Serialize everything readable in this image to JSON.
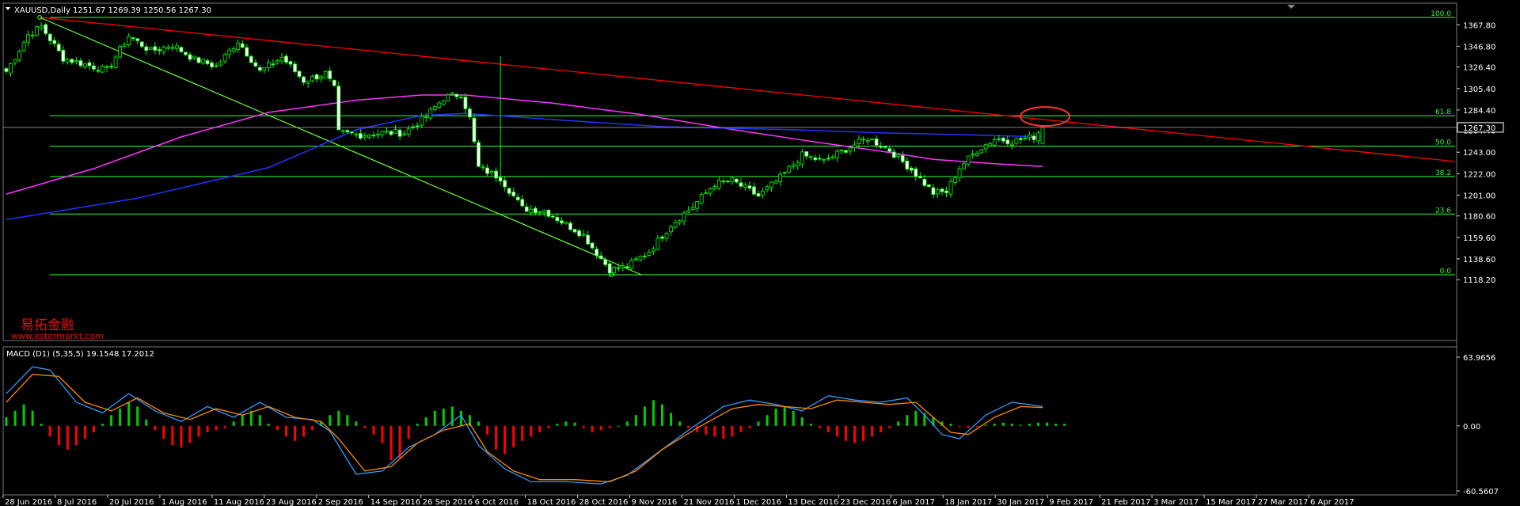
{
  "header": {
    "symbol_title": "XAUUSD,Daily",
    "ohlc": "1251.67 1269.39 1250.56 1267.30",
    "collapse_icon": "triangle-down-icon"
  },
  "watermark": {
    "brand": "易拓金融",
    "url": "www.estermarkt.com"
  },
  "colors": {
    "background": "#000000",
    "bull_candle": "#00ff00",
    "bear_candle": "#ffffff",
    "fib_lines": "#33ff33",
    "trendline_resistance": "#ff0000",
    "trendline_fib_anchor": "#66ff33",
    "ma_magenta": "#ff33ff",
    "ma_blue": "#2233ff",
    "macd_line": "#3399ff",
    "signal_line": "#ff8800",
    "hist_positive": "#00cc00",
    "hist_negative": "#ff0000",
    "highlight_ellipse": "#ff3333"
  },
  "price_axis": {
    "ticks": [
      "1367.80",
      "1346.80",
      "1326.40",
      "1305.40",
      "1284.40",
      "1264.40",
      "1243.00",
      "1222.00",
      "1201.00",
      "1180.60",
      "1159.60",
      "1138.60",
      "1118.20"
    ],
    "current_price": "1267.30"
  },
  "time_axis": {
    "labels": [
      "28 Jun 2016",
      "8 Jul 2016",
      "20 Jul 2016",
      "1 Aug 2016",
      "11 Aug 2016",
      "23 Aug 2016",
      "2 Sep 2016",
      "14 Sep 2016",
      "26 Sep 2016",
      "6 Oct 2016",
      "18 Oct 2016",
      "28 Oct 2016",
      "9 Nov 2016",
      "21 Nov 2016",
      "1 Dec 2016",
      "13 Dec 2016",
      "23 Dec 2016",
      "6 Jan 2017",
      "18 Jan 2017",
      "30 Jan 2017",
      "9 Feb 2017",
      "21 Feb 2017",
      "3 Mar 2017",
      "15 Mar 2017",
      "27 Mar 2017",
      "6 Apr 2017"
    ]
  },
  "fib_levels": [
    "100.0",
    "61.8",
    "50.0",
    "38.2",
    "23.6",
    "0.0"
  ],
  "macd": {
    "title": "MACD (D1) (5,35,5) 19.1548 17.2012",
    "axis_ticks": [
      "63.9656",
      "0.00",
      "-60.5607"
    ]
  },
  "chart_data": {
    "type": "candlestick",
    "symbol": "XAUUSD",
    "timeframe": "Daily",
    "last_bar": {
      "open": 1251.67,
      "high": 1269.39,
      "low": 1250.56,
      "close": 1267.3
    },
    "ylim": [
      1112,
      1381
    ],
    "close_path": [
      [
        0,
        1322
      ],
      [
        5,
        1358
      ],
      [
        8,
        1366
      ],
      [
        13,
        1335
      ],
      [
        18,
        1329
      ],
      [
        23,
        1323
      ],
      [
        28,
        1357
      ],
      [
        33,
        1342
      ],
      [
        38,
        1348
      ],
      [
        43,
        1334
      ],
      [
        48,
        1327
      ],
      [
        53,
        1352
      ],
      [
        58,
        1322
      ],
      [
        63,
        1336
      ],
      [
        68,
        1313
      ],
      [
        73,
        1320
      ],
      [
        75,
        1305
      ],
      [
        76,
        1262
      ],
      [
        81,
        1260
      ],
      [
        86,
        1262
      ],
      [
        91,
        1262
      ],
      [
        96,
        1278
      ],
      [
        100,
        1296
      ],
      [
        104,
        1300
      ],
      [
        106,
        1276
      ],
      [
        108,
        1228
      ],
      [
        113,
        1218
      ],
      [
        118,
        1188
      ],
      [
        123,
        1186
      ],
      [
        127,
        1175
      ],
      [
        132,
        1162
      ],
      [
        134,
        1150
      ],
      [
        138,
        1128
      ],
      [
        142,
        1131
      ],
      [
        147,
        1146
      ],
      [
        152,
        1172
      ],
      [
        157,
        1190
      ],
      [
        162,
        1212
      ],
      [
        166,
        1215
      ],
      [
        172,
        1200
      ],
      [
        177,
        1218
      ],
      [
        182,
        1240
      ],
      [
        187,
        1234
      ],
      [
        192,
        1246
      ],
      [
        197,
        1257
      ],
      [
        202,
        1245
      ],
      [
        207,
        1226
      ],
      [
        212,
        1203
      ],
      [
        215,
        1204
      ],
      [
        218,
        1228
      ],
      [
        222,
        1245
      ],
      [
        226,
        1256
      ],
      [
        230,
        1254
      ],
      [
        235,
        1258
      ],
      [
        237,
        1267.3
      ]
    ],
    "fibonacci": {
      "anchor_high": 1375,
      "anchor_low": 1123,
      "levels": [
        100.0,
        61.8,
        50.0,
        38.2,
        23.6,
        0.0
      ]
    },
    "trendlines": {
      "resistance": [
        [
          8,
          1375
        ],
        [
          265,
          1234
        ]
      ],
      "fib_anchor": [
        [
          8,
          1375
        ],
        [
          138,
          1123
        ]
      ]
    },
    "ma_magenta_path": [
      [
        0,
        1202
      ],
      [
        20,
        1227
      ],
      [
        40,
        1258
      ],
      [
        60,
        1282
      ],
      [
        80,
        1294
      ],
      [
        95,
        1299
      ],
      [
        105,
        1299
      ],
      [
        125,
        1291
      ],
      [
        145,
        1280
      ],
      [
        165,
        1266
      ],
      [
        185,
        1253
      ],
      [
        200,
        1244
      ],
      [
        212,
        1236
      ],
      [
        225,
        1232
      ],
      [
        237,
        1229
      ]
    ],
    "ma_blue_path": [
      [
        0,
        1177
      ],
      [
        30,
        1198
      ],
      [
        60,
        1228
      ],
      [
        80,
        1265
      ],
      [
        95,
        1279
      ],
      [
        105,
        1281
      ],
      [
        125,
        1275
      ],
      [
        150,
        1268
      ],
      [
        180,
        1265
      ],
      [
        200,
        1262
      ],
      [
        220,
        1260
      ],
      [
        237,
        1258
      ]
    ],
    "macd_hist": [
      8,
      14,
      20,
      14,
      2,
      -10,
      -18,
      -22,
      -18,
      -12,
      -6,
      2,
      10,
      16,
      22,
      18,
      6,
      -4,
      -12,
      -18,
      -20,
      -16,
      -10,
      -6,
      -4,
      -2,
      4,
      10,
      14,
      10,
      2,
      -4,
      -10,
      -14,
      -10,
      -4,
      4,
      10,
      14,
      10,
      4,
      -2,
      -8,
      -16,
      -32,
      -30,
      -12,
      2,
      8,
      14,
      16,
      18,
      14,
      10,
      4,
      -8,
      -22,
      -26,
      -20,
      -14,
      -10,
      -6,
      -2,
      2,
      4,
      3,
      -2,
      -6,
      -4,
      -2,
      0,
      4,
      10,
      18,
      24,
      20,
      12,
      4,
      -2,
      -6,
      -8,
      -10,
      -12,
      -10,
      -6,
      -2,
      4,
      10,
      16,
      18,
      14,
      8,
      2,
      -2,
      -6,
      -10,
      -14,
      -16,
      -14,
      -10,
      -6,
      -2,
      4,
      10,
      14,
      12,
      8,
      4,
      2,
      -1,
      -2,
      -1,
      1,
      2,
      3,
      2,
      1,
      2,
      3,
      3,
      2,
      2
    ],
    "macd_line": [
      [
        0,
        30
      ],
      [
        6,
        55
      ],
      [
        10,
        52
      ],
      [
        16,
        22
      ],
      [
        22,
        12
      ],
      [
        28,
        30
      ],
      [
        34,
        14
      ],
      [
        40,
        4
      ],
      [
        46,
        18
      ],
      [
        52,
        8
      ],
      [
        58,
        22
      ],
      [
        64,
        8
      ],
      [
        70,
        6
      ],
      [
        74,
        -5
      ],
      [
        80,
        -45
      ],
      [
        86,
        -42
      ],
      [
        92,
        -20
      ],
      [
        98,
        -8
      ],
      [
        104,
        10
      ],
      [
        108,
        -18
      ],
      [
        114,
        -40
      ],
      [
        120,
        -52
      ],
      [
        128,
        -52
      ],
      [
        136,
        -54
      ],
      [
        142,
        -46
      ],
      [
        148,
        -28
      ],
      [
        156,
        -4
      ],
      [
        164,
        18
      ],
      [
        170,
        24
      ],
      [
        176,
        20
      ],
      [
        182,
        14
      ],
      [
        188,
        28
      ],
      [
        194,
        24
      ],
      [
        200,
        22
      ],
      [
        206,
        26
      ],
      [
        210,
        10
      ],
      [
        214,
        -8
      ],
      [
        218,
        -12
      ],
      [
        224,
        10
      ],
      [
        230,
        22
      ],
      [
        237,
        18
      ]
    ],
    "signal_line": [
      [
        0,
        22
      ],
      [
        6,
        48
      ],
      [
        12,
        46
      ],
      [
        18,
        22
      ],
      [
        24,
        14
      ],
      [
        30,
        26
      ],
      [
        36,
        12
      ],
      [
        42,
        6
      ],
      [
        48,
        16
      ],
      [
        54,
        10
      ],
      [
        60,
        18
      ],
      [
        66,
        8
      ],
      [
        72,
        4
      ],
      [
        76,
        -12
      ],
      [
        82,
        -42
      ],
      [
        88,
        -38
      ],
      [
        94,
        -16
      ],
      [
        100,
        -4
      ],
      [
        106,
        2
      ],
      [
        110,
        -24
      ],
      [
        116,
        -42
      ],
      [
        122,
        -50
      ],
      [
        130,
        -50
      ],
      [
        138,
        -52
      ],
      [
        144,
        -42
      ],
      [
        150,
        -22
      ],
      [
        158,
        -2
      ],
      [
        166,
        16
      ],
      [
        172,
        20
      ],
      [
        178,
        18
      ],
      [
        184,
        16
      ],
      [
        190,
        24
      ],
      [
        196,
        22
      ],
      [
        202,
        20
      ],
      [
        208,
        22
      ],
      [
        212,
        8
      ],
      [
        216,
        -6
      ],
      [
        220,
        -8
      ],
      [
        226,
        8
      ],
      [
        232,
        18
      ],
      [
        237,
        17
      ]
    ],
    "macd_ylim": [
      -60.5607,
      63.9656
    ]
  }
}
